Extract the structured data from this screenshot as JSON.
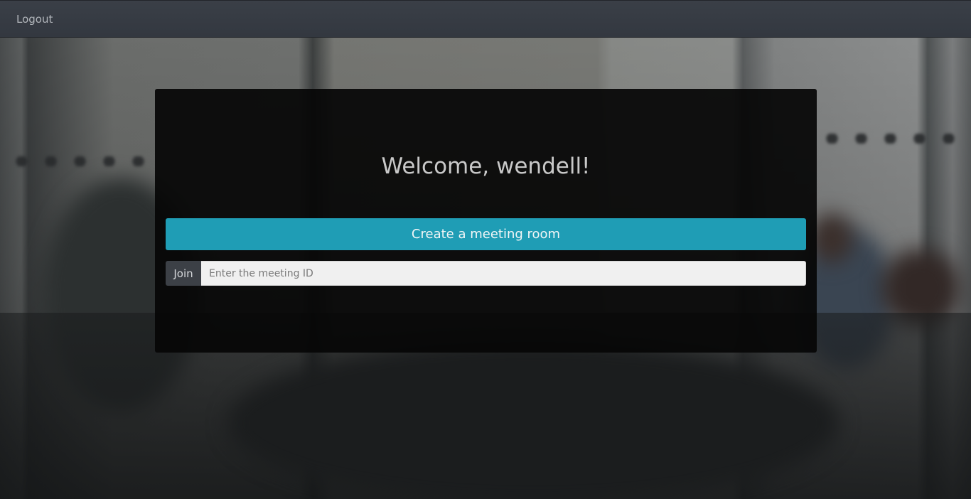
{
  "nav": {
    "logout_label": "Logout"
  },
  "card": {
    "welcome_text": "Welcome, wendell!",
    "create_button_label": "Create a meeting room",
    "join_label": "Join",
    "meeting_id_value": "",
    "meeting_id_placeholder": "Enter the meeting ID"
  },
  "colors": {
    "topbar": "#363b43",
    "create_button": "#1f9db5",
    "card_background": "#060606"
  }
}
